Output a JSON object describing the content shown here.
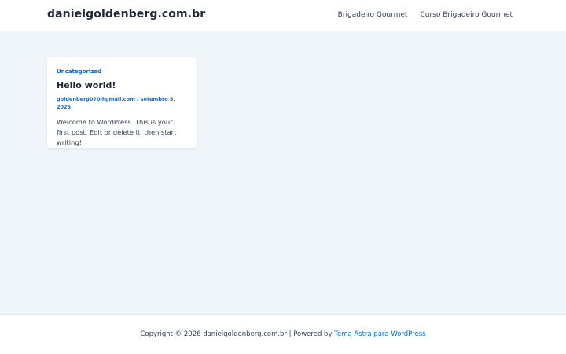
{
  "header": {
    "site_title": "danielgoldenberg.com.br",
    "nav": [
      {
        "label": "Brigadeiro Gourmet"
      },
      {
        "label": "Curso Brigadeiro Gourmet"
      }
    ]
  },
  "post": {
    "category": "Uncategorized",
    "title": "Hello world!",
    "author": "goldenberg070@gmail.com",
    "separator": "/",
    "date": "setembro 5, 2025",
    "excerpt": "Welcome to WordPress. This is your first post. Edit or delete it, then start writing!"
  },
  "footer": {
    "copyright": "Copyright © 2026 danielgoldenberg.com.br | Powered by ",
    "theme_link": "Tema Astra para WordPress"
  },
  "colors": {
    "accent": "#046bd2",
    "page_background": "#f0f5fa",
    "heading": "#1e293b"
  }
}
